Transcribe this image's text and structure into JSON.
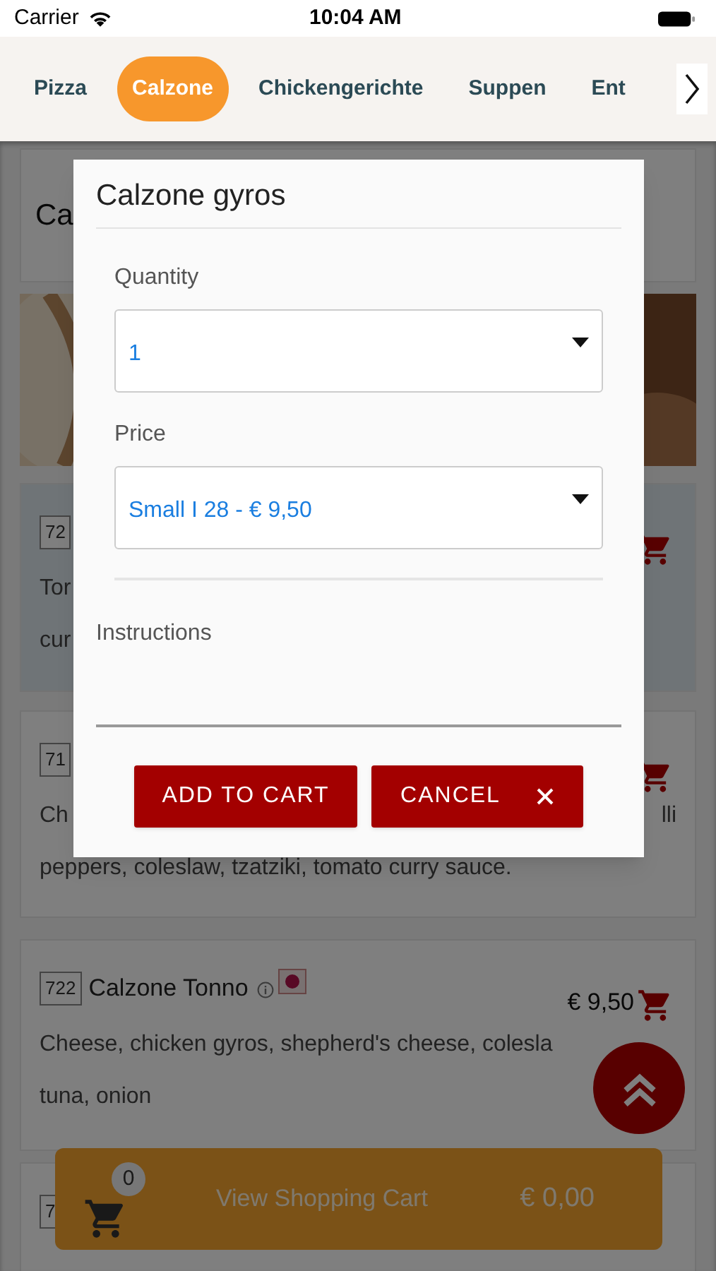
{
  "status_bar": {
    "carrier": "Carrier",
    "time": "10:04 AM"
  },
  "category_tabs": [
    {
      "label": "Pizza",
      "selected": false
    },
    {
      "label": "Calzone",
      "selected": true
    },
    {
      "label": "Chickengerichte",
      "selected": false
    },
    {
      "label": "Suppen",
      "selected": false
    },
    {
      "label": "Ent",
      "selected": false
    }
  ],
  "category_heading": "Ca",
  "menu_items": [
    {
      "number": "72",
      "highlighted": true,
      "lines": [
        {
          "left": "Tor"
        },
        {
          "left": "cur"
        }
      ]
    },
    {
      "number": "71",
      "highlighted": false,
      "lines": [
        {
          "left": "Ch",
          "right": "lli"
        },
        {
          "left": "peppers, coleslaw, tzatziki, tomato curry sauce."
        }
      ]
    },
    {
      "number": "722",
      "highlighted": false,
      "name": "Calzone Tonno",
      "price": "€ 9,50",
      "lines": [
        {
          "left": "Cheese, chicken gyros, shepherd's cheese, colesla"
        },
        {
          "left": "tuna, onion"
        }
      ]
    },
    {
      "number": "7",
      "highlighted": false
    }
  ],
  "cart_bar": {
    "count": "0",
    "label": "View Shopping Cart",
    "total": "€ 0,00"
  },
  "dialog": {
    "title": "Calzone gyros",
    "fields": [
      {
        "label": "Quantity",
        "value": "1"
      },
      {
        "label": "Price",
        "value": "Small I 28 - € 9,50"
      }
    ],
    "instructions": {
      "label": "Instructions"
    },
    "buttons": [
      {
        "label": "ADD TO CART",
        "kind": "add"
      },
      {
        "label": "CANCEL",
        "kind": "cancel"
      }
    ]
  }
}
